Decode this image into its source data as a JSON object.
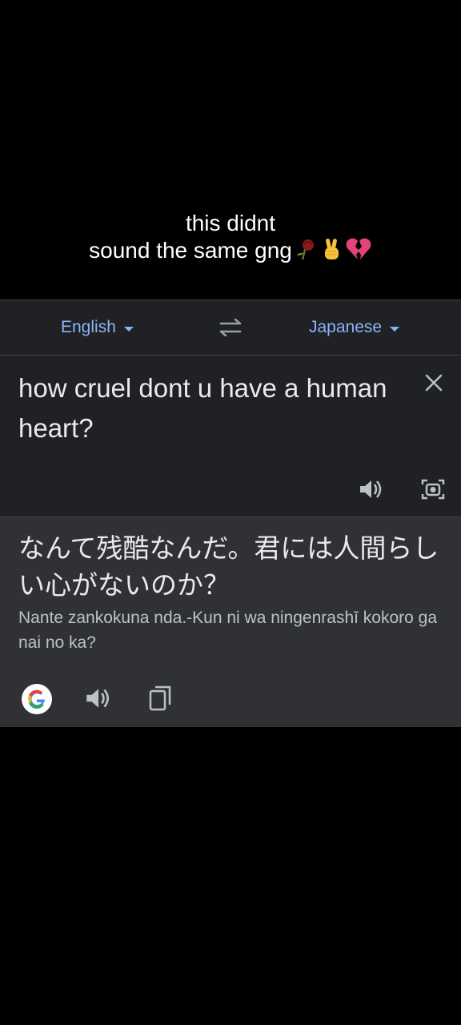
{
  "caption": {
    "line1": "this didnt",
    "line2": "sound the same gng",
    "emojis": [
      "wilted-rose-emoji",
      "victory-hand-emoji",
      "broken-heart-emoji"
    ]
  },
  "translator": {
    "source_language": "English",
    "target_language": "Japanese",
    "source_text": "how cruel dont u have a human heart?",
    "translated_text": "なんて残酷なんだ。君には人間らしい心がないのか？",
    "romanization": "Nante zankokuna nda.-Kun ni wa ningenrashī kokoro ga nai no ka?"
  },
  "icons": {
    "swap": "swap-languages-icon",
    "clear": "close-icon",
    "source_speaker": "speaker-icon",
    "camera": "camera-icon",
    "google": "google-logo-icon",
    "result_speaker": "speaker-icon",
    "copy": "copy-icon"
  },
  "colors": {
    "accent": "#8ab4f8",
    "panel": "#202124",
    "result_panel": "#303134"
  }
}
